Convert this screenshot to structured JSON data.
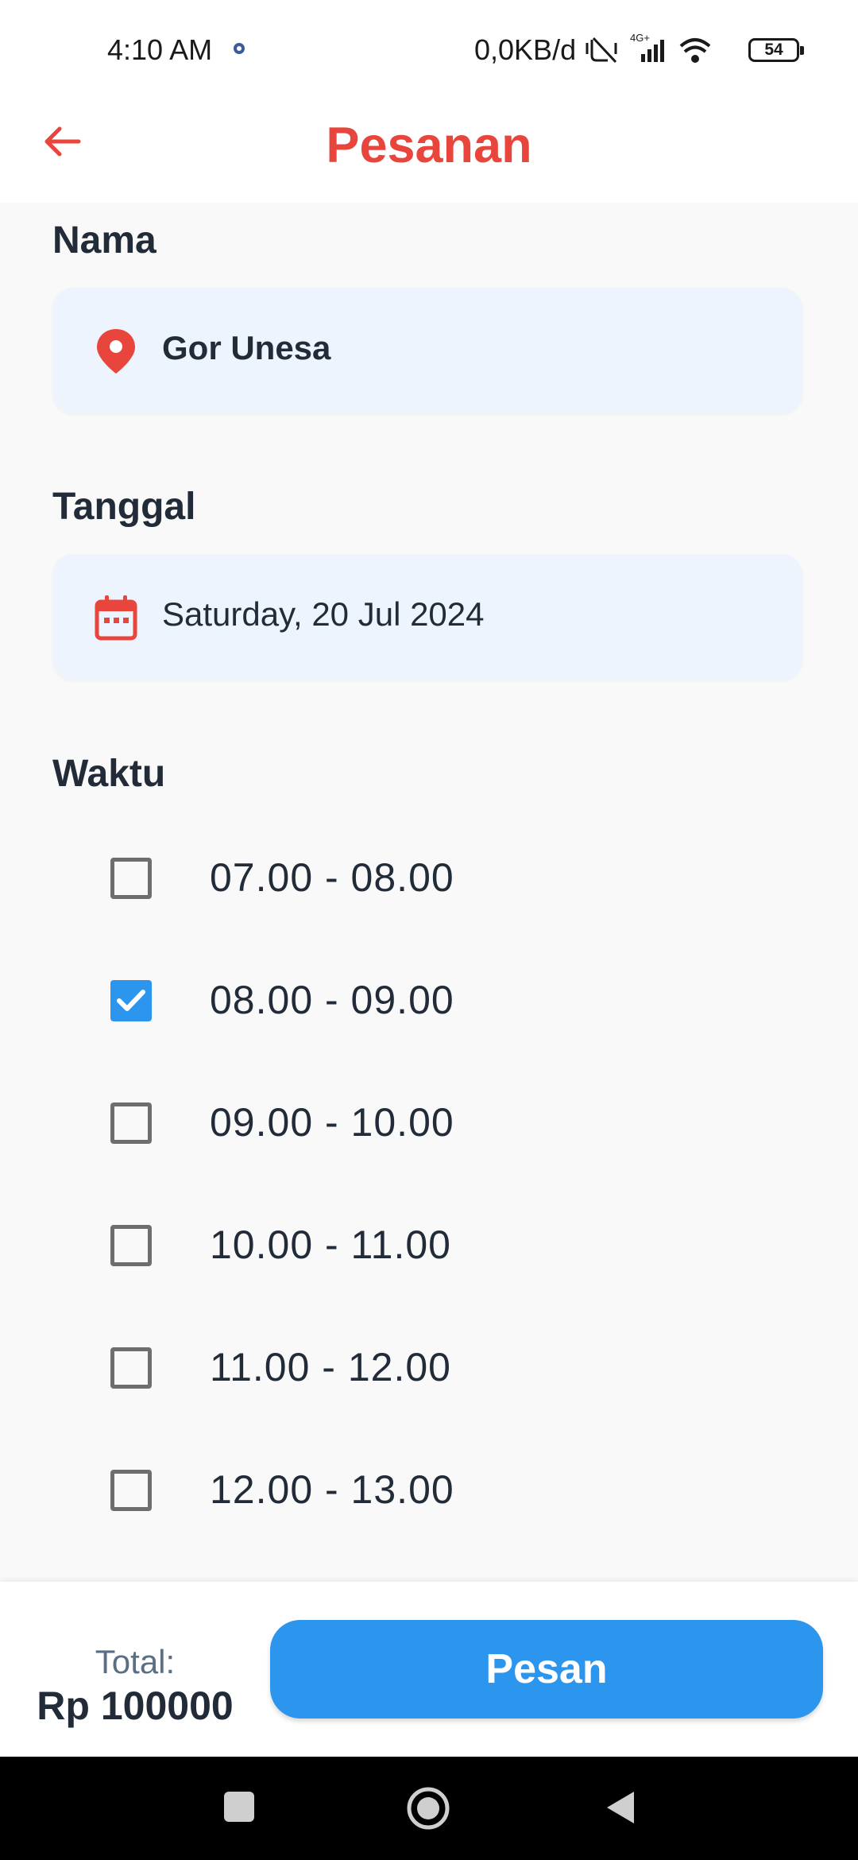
{
  "status_bar": {
    "time": "4:10 AM",
    "network_speed": "0,0KB/d",
    "network_type": "4G+",
    "battery": "54",
    "icons": [
      "gear-icon",
      "vibrate-icon",
      "signal-icon",
      "wifi-icon",
      "battery-icon"
    ]
  },
  "app_bar": {
    "title": "Pesanan",
    "back_icon": "arrow-left-icon"
  },
  "form": {
    "name_label": "Nama",
    "name_value": "Gor Unesa",
    "name_icon": "location-pin-icon",
    "date_label": "Tanggal",
    "date_value": "Saturday, 20 Jul 2024",
    "date_icon": "calendar-icon",
    "time_label": "Waktu",
    "slots": [
      {
        "label": "07.00 - 08.00",
        "checked": false
      },
      {
        "label": "08.00 - 09.00",
        "checked": true
      },
      {
        "label": "09.00 - 10.00",
        "checked": false
      },
      {
        "label": "10.00 - 11.00",
        "checked": false
      },
      {
        "label": "11.00 - 12.00",
        "checked": false
      },
      {
        "label": "12.00 - 13.00",
        "checked": false
      }
    ]
  },
  "footer": {
    "total_label": "Total:",
    "total_value": "Rp 100000",
    "order_button": "Pesan"
  },
  "colors": {
    "accent_red": "#e8453c",
    "primary_blue": "#2c95ee",
    "field_bg": "#edf4fe"
  }
}
